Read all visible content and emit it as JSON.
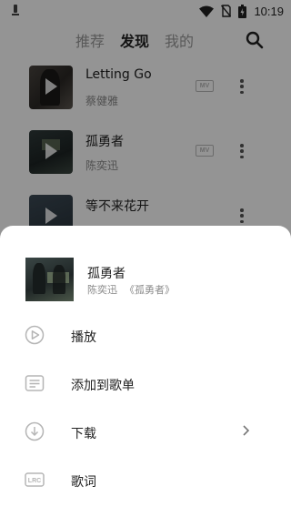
{
  "status_bar": {
    "time": "10:19"
  },
  "nav": {
    "tabs": [
      {
        "label": "推荐",
        "active": false
      },
      {
        "label": "发现",
        "active": true
      },
      {
        "label": "我的",
        "active": false
      }
    ]
  },
  "songs": [
    {
      "title": "Letting Go",
      "artist": "蔡健雅",
      "has_mv": true
    },
    {
      "title": "孤勇者",
      "artist": "陈奕迅",
      "has_mv": true
    },
    {
      "title": "等不来花开",
      "artist": "",
      "has_mv": false
    }
  ],
  "mv_label": "MV",
  "sheet": {
    "song_title": "孤勇者",
    "artist": "陈奕迅",
    "album": "《孤勇者》",
    "actions": [
      {
        "label": "播放",
        "icon": "play-circle-icon"
      },
      {
        "label": "添加到歌单",
        "icon": "playlist-add-icon"
      },
      {
        "label": "下载",
        "icon": "download-icon"
      },
      {
        "label": "歌词",
        "icon": "lyrics-icon"
      }
    ],
    "lyrics_badge": "LRC"
  },
  "colors": {
    "scrim": "#000000",
    "text_primary": "#222222",
    "text_secondary": "#8a8a8a",
    "icon_gray": "#b5b5b5"
  }
}
